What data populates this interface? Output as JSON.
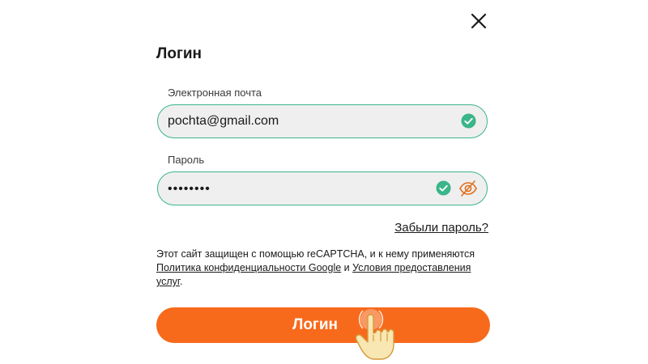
{
  "dialog": {
    "title": "Логин",
    "close_icon": "close-icon"
  },
  "email": {
    "label": "Электронная почта",
    "value": "pochta@gmail.com",
    "valid": true
  },
  "password": {
    "label": "Пароль",
    "masked_value": "••••••••",
    "valid": true,
    "visibility_icon": "eye-slash-icon"
  },
  "forgot_password": "Забыли пароль?",
  "recaptcha": {
    "prefix": "Этот сайт защищен с помощью reCAPTCHA, и к нему применяются ",
    "privacy_link": "Политика конфиденциальности Google",
    "conjunction": " и ",
    "terms_link": "Условия предоставления услуг",
    "suffix": "."
  },
  "login_button": "Логин",
  "colors": {
    "accent": "#f86a1b",
    "valid": "#3bb58a",
    "input_bg": "#efefef"
  }
}
